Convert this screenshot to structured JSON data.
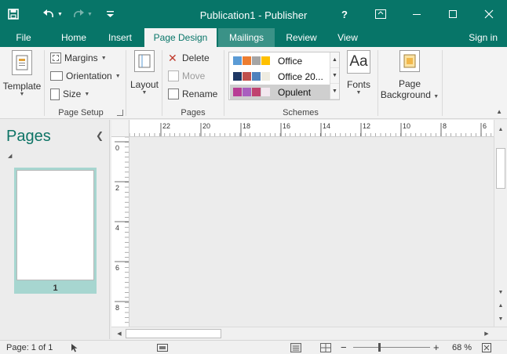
{
  "app": {
    "title": "Publication1 - Publisher"
  },
  "window": {
    "help_label": "?"
  },
  "tabs": [
    {
      "label": "File"
    },
    {
      "label": "Home"
    },
    {
      "label": "Insert"
    },
    {
      "label": "Page Design"
    },
    {
      "label": "Mailings"
    },
    {
      "label": "Review"
    },
    {
      "label": "View"
    }
  ],
  "signin_label": "Sign in",
  "ribbon": {
    "template": {
      "label": "Template"
    },
    "page_setup": {
      "margins": "Margins",
      "orientation": "Orientation",
      "size": "Size",
      "group_label": "Page Setup"
    },
    "layout": {
      "label": "Layout"
    },
    "pages": {
      "delete": "Delete",
      "move": "Move",
      "rename": "Rename",
      "group_label": "Pages"
    },
    "schemes": {
      "group_label": "Schemes",
      "items": [
        {
          "name": "Office",
          "colors": [
            "#5b9bd5",
            "#ed7d31",
            "#a5a5a5",
            "#ffc000"
          ]
        },
        {
          "name": "Office 20...",
          "colors": [
            "#1f3864",
            "#c0504d",
            "#4f81bd",
            "#eeece1"
          ]
        },
        {
          "name": "Opulent",
          "colors": [
            "#b83d95",
            "#a95fbf",
            "#c0426f",
            "#f3e8f0"
          ],
          "selected": true
        }
      ]
    },
    "fonts": {
      "icon_text": "Aa",
      "label": "Fonts"
    },
    "page_background": {
      "line1": "Page",
      "line2": "Background"
    }
  },
  "pages_pane": {
    "title": "Pages",
    "thumbnail_number": "1"
  },
  "rulers": {
    "horizontal": [
      "22",
      "20",
      "18",
      "16",
      "14",
      "12",
      "10",
      "8",
      "6"
    ],
    "vertical": [
      "0",
      "2",
      "4",
      "6",
      "8"
    ]
  },
  "status": {
    "page": "Page: 1 of 1",
    "zoom": "68 %",
    "zoom_level": 0.68
  },
  "colors": {
    "accent": "#077568",
    "pages_title": "#0e7466",
    "thumb_highlight": "#a7d6d0"
  }
}
